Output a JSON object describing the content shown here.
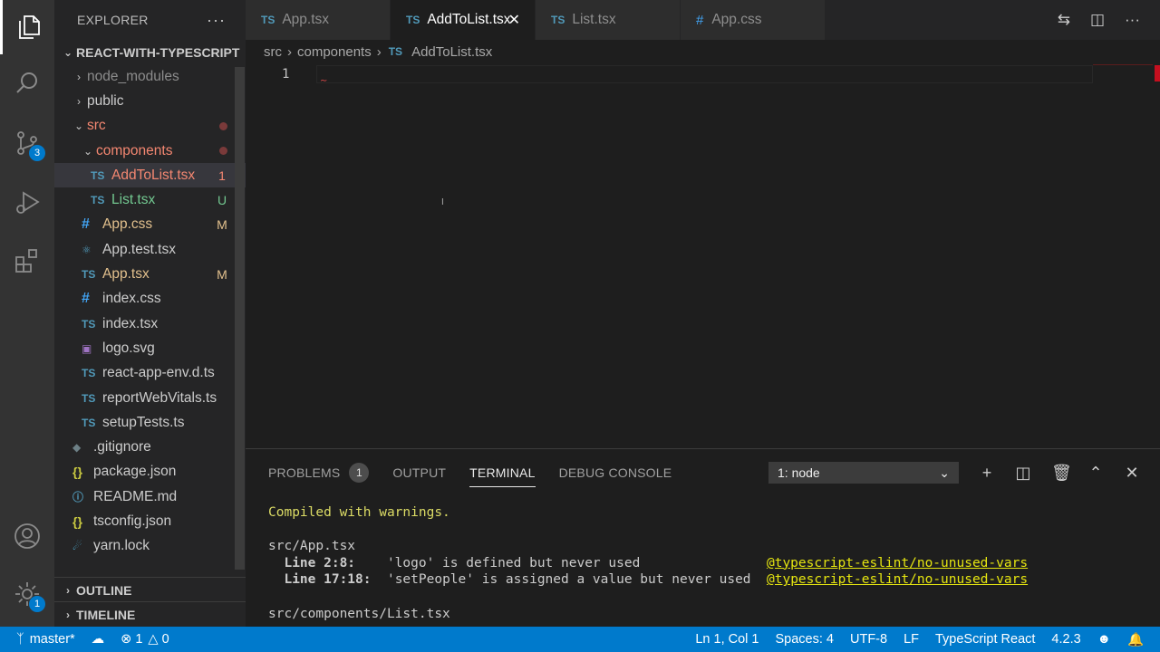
{
  "explorer": {
    "title": "EXPLORER",
    "more": "···",
    "project": "REACT-WITH-TYPESCRIPT",
    "items": [
      {
        "label": "node_modules",
        "type": "folder",
        "indent": 1,
        "open": false,
        "status": ""
      },
      {
        "label": "public",
        "type": "folder",
        "indent": 1,
        "open": false,
        "status": ""
      },
      {
        "label": "src",
        "type": "folder",
        "indent": 1,
        "open": true,
        "status": "dot"
      },
      {
        "label": "components",
        "type": "folder",
        "indent": 2,
        "open": true,
        "status": "dot"
      },
      {
        "label": "AddToList.tsx",
        "type": "ts",
        "indent": 3,
        "status": "1"
      },
      {
        "label": "List.tsx",
        "type": "ts",
        "indent": 3,
        "status": "U"
      },
      {
        "label": "App.css",
        "type": "css",
        "indent": 2,
        "status": "M"
      },
      {
        "label": "App.test.tsx",
        "type": "react",
        "indent": 2,
        "status": ""
      },
      {
        "label": "App.tsx",
        "type": "ts",
        "indent": 2,
        "status": "M"
      },
      {
        "label": "index.css",
        "type": "css",
        "indent": 2,
        "status": ""
      },
      {
        "label": "index.tsx",
        "type": "ts",
        "indent": 2,
        "status": ""
      },
      {
        "label": "logo.svg",
        "type": "svg",
        "indent": 2,
        "status": ""
      },
      {
        "label": "react-app-env.d.ts",
        "type": "ts",
        "indent": 2,
        "status": ""
      },
      {
        "label": "reportWebVitals.ts",
        "type": "ts",
        "indent": 2,
        "status": ""
      },
      {
        "label": "setupTests.ts",
        "type": "ts",
        "indent": 2,
        "status": ""
      },
      {
        "label": ".gitignore",
        "type": "git",
        "indent": 1,
        "status": ""
      },
      {
        "label": "package.json",
        "type": "json",
        "indent": 1,
        "status": ""
      },
      {
        "label": "README.md",
        "type": "md",
        "indent": 1,
        "status": ""
      },
      {
        "label": "tsconfig.json",
        "type": "json",
        "indent": 1,
        "status": ""
      },
      {
        "label": "yarn.lock",
        "type": "yarn",
        "indent": 1,
        "status": ""
      }
    ],
    "outline": "OUTLINE",
    "timeline": "TIMELINE"
  },
  "activity": {
    "scm_badge": "3",
    "settings_badge": "1"
  },
  "tabs": [
    {
      "label": "App.tsx",
      "icon": "TS",
      "active": false
    },
    {
      "label": "AddToList.tsx",
      "icon": "TS",
      "active": true
    },
    {
      "label": "List.tsx",
      "icon": "TS",
      "active": false
    },
    {
      "label": "App.css",
      "icon": "#",
      "active": false
    }
  ],
  "breadcrumb": {
    "parts": [
      "src",
      "components"
    ],
    "file_icon": "TS",
    "file": "AddToList.tsx"
  },
  "editor": {
    "line_number": "1"
  },
  "panel": {
    "tabs": {
      "problems": "PROBLEMS",
      "problems_count": "1",
      "output": "OUTPUT",
      "terminal": "TERMINAL",
      "debug": "DEBUG CONSOLE"
    },
    "terminal_select": "1: node",
    "terminal": {
      "line1": "Compiled with warnings.",
      "file1": "src/App.tsx",
      "w1_loc": "  Line 2:8:",
      "w1_msg": "    'logo' is defined but never used                ",
      "w1_rule": "@typescript-eslint/no-unused-vars",
      "w2_loc": "  Line 17:18:",
      "w2_msg": "  'setPeople' is assigned a value but never used  ",
      "w2_rule": "@typescript-eslint/no-unused-vars",
      "file2": "src/components/List.tsx"
    }
  },
  "status": {
    "branch": "master*",
    "errors": "1",
    "warnings": "0",
    "position": "Ln 1, Col 1",
    "spaces": "Spaces: 4",
    "encoding": "UTF-8",
    "eol": "LF",
    "language": "TypeScript React",
    "version": "4.2.3"
  },
  "colors": {
    "accent": "#007acc",
    "error": "#f48771",
    "untracked": "#73c991",
    "modified": "#e2c08d"
  }
}
